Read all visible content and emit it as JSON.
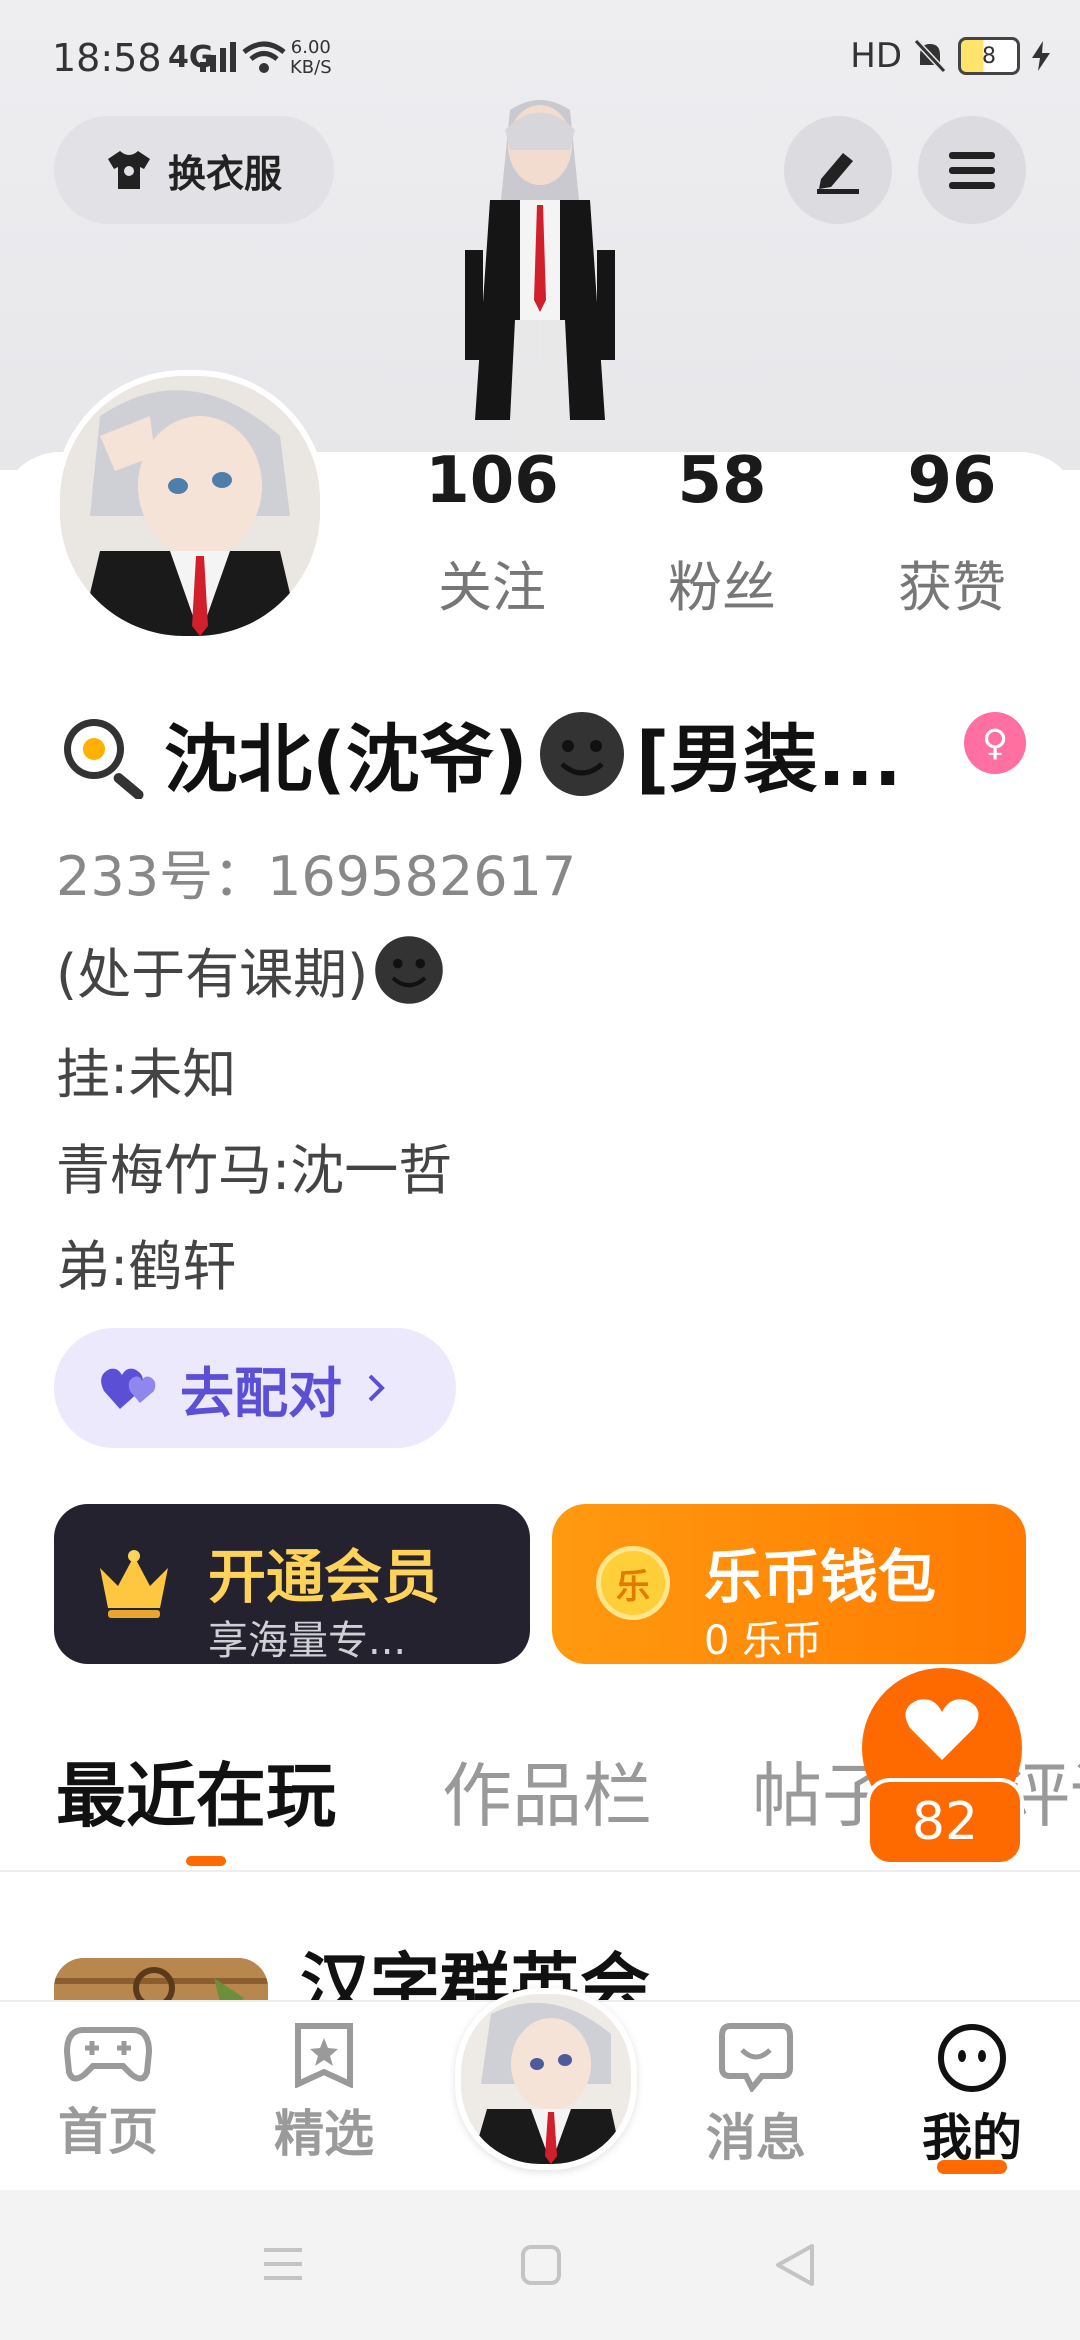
{
  "status_bar": {
    "time": "18:58",
    "network": "4G",
    "speed_value": "6.00",
    "speed_unit": "KB/S",
    "hd": "HD",
    "battery": "8"
  },
  "header": {
    "dress_up_label": "换衣服"
  },
  "profile": {
    "stats": [
      {
        "value": "106",
        "label": "关注"
      },
      {
        "value": "58",
        "label": "粉丝"
      },
      {
        "value": "96",
        "label": "获赞"
      }
    ],
    "name": "沈北(沈爷)",
    "name_suffix": "[男装...",
    "gender_symbol": "♀",
    "uid": "233号：169582617",
    "bio_lines": [
      "(处于有课期)",
      "挂:未知",
      "青梅竹马:沈一哲",
      "弟:鹤轩"
    ],
    "pair_button_label": "去配对"
  },
  "cards": {
    "vip_title": "开通会员",
    "vip_sub": "享海量专...",
    "wallet_title": "乐币钱包",
    "wallet_sub": "0 乐币",
    "wallet_coin_label": "乐"
  },
  "tabs": [
    {
      "label": "最近在玩",
      "active": true
    },
    {
      "label": "作品栏",
      "active": false
    },
    {
      "label": "帖子",
      "active": false
    },
    {
      "label": "评论",
      "active": false
    }
  ],
  "like_count": "82",
  "recent_game_title": "汉字群英会",
  "bottom_nav": [
    {
      "label": "首页",
      "icon": "gamepad-icon"
    },
    {
      "label": "精选",
      "icon": "star-bookmark-icon"
    },
    {
      "label": "消息",
      "icon": "chat-bubble-icon"
    },
    {
      "label": "我的",
      "icon": "face-icon",
      "active": true
    }
  ],
  "colors": {
    "accent": "#ff6a00",
    "pair_purple": "#5b4fd6",
    "vip_gold": "#ffd25a",
    "gender_pink": "#ff6fa0"
  }
}
